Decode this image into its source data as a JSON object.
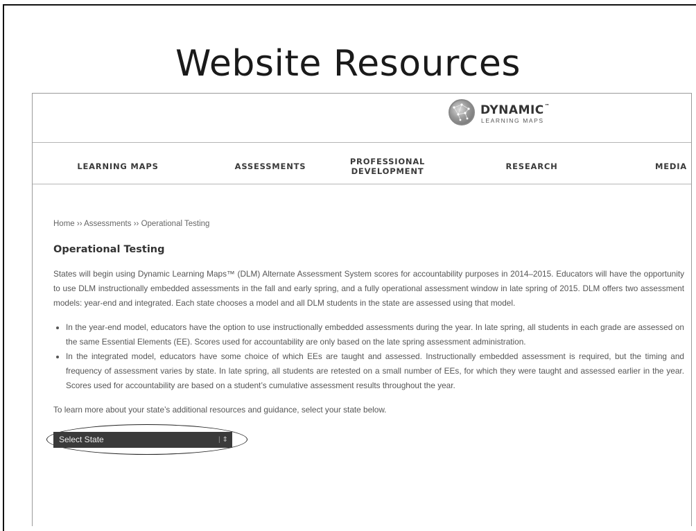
{
  "slide": {
    "title": "Website Resources"
  },
  "logo": {
    "name": "DYNAMIC",
    "trademark": "™",
    "subtitle": "LEARNING MAPS"
  },
  "nav": {
    "items": [
      {
        "label": "LEARNING MAPS"
      },
      {
        "label": "ASSESSMENTS"
      },
      {
        "label": "PROFESSIONAL\nDEVELOPMENT"
      },
      {
        "label": "RESEARCH"
      },
      {
        "label": "MEDIA"
      }
    ]
  },
  "breadcrumb": {
    "home": "Home",
    "sep": " ›› ",
    "section": "Assessments",
    "current": "Operational Testing"
  },
  "page": {
    "heading": "Operational Testing",
    "intro": "States will begin using Dynamic Learning Maps™ (DLM) Alternate Assessment System scores for accountability purposes in 2014–2015. Educators will have the opportunity to use DLM instructionally embedded assessments in the fall and early spring, and a fully operational assessment window in late spring of 2015. DLM offers two assessment models: year-end and integrated. Each state chooses a model and all DLM students in the state are assessed using that model.",
    "bullets": [
      "In the year-end model, educators have the option to use instructionally embedded assessments during the year. In late spring, all students in each grade are assessed on the same Essential Elements (EE). Scores used for accountability are only based on the late spring assessment administration.",
      "In the integrated model, educators have some choice of which EEs are taught and assessed. Instructionally embedded assessment is required, but the timing and frequency of assessment varies by state. In late spring, all students are retested on a small number of EEs, for which they were taught and assessed earlier in the year. Scores used for accountability are based on a student’s cumulative assessment results throughout the year."
    ],
    "prompt": "To learn more about your state’s additional resources and guidance, select your state below.",
    "select": {
      "selected": "Select State",
      "arrow_icon": "updown-arrow-icon"
    }
  }
}
